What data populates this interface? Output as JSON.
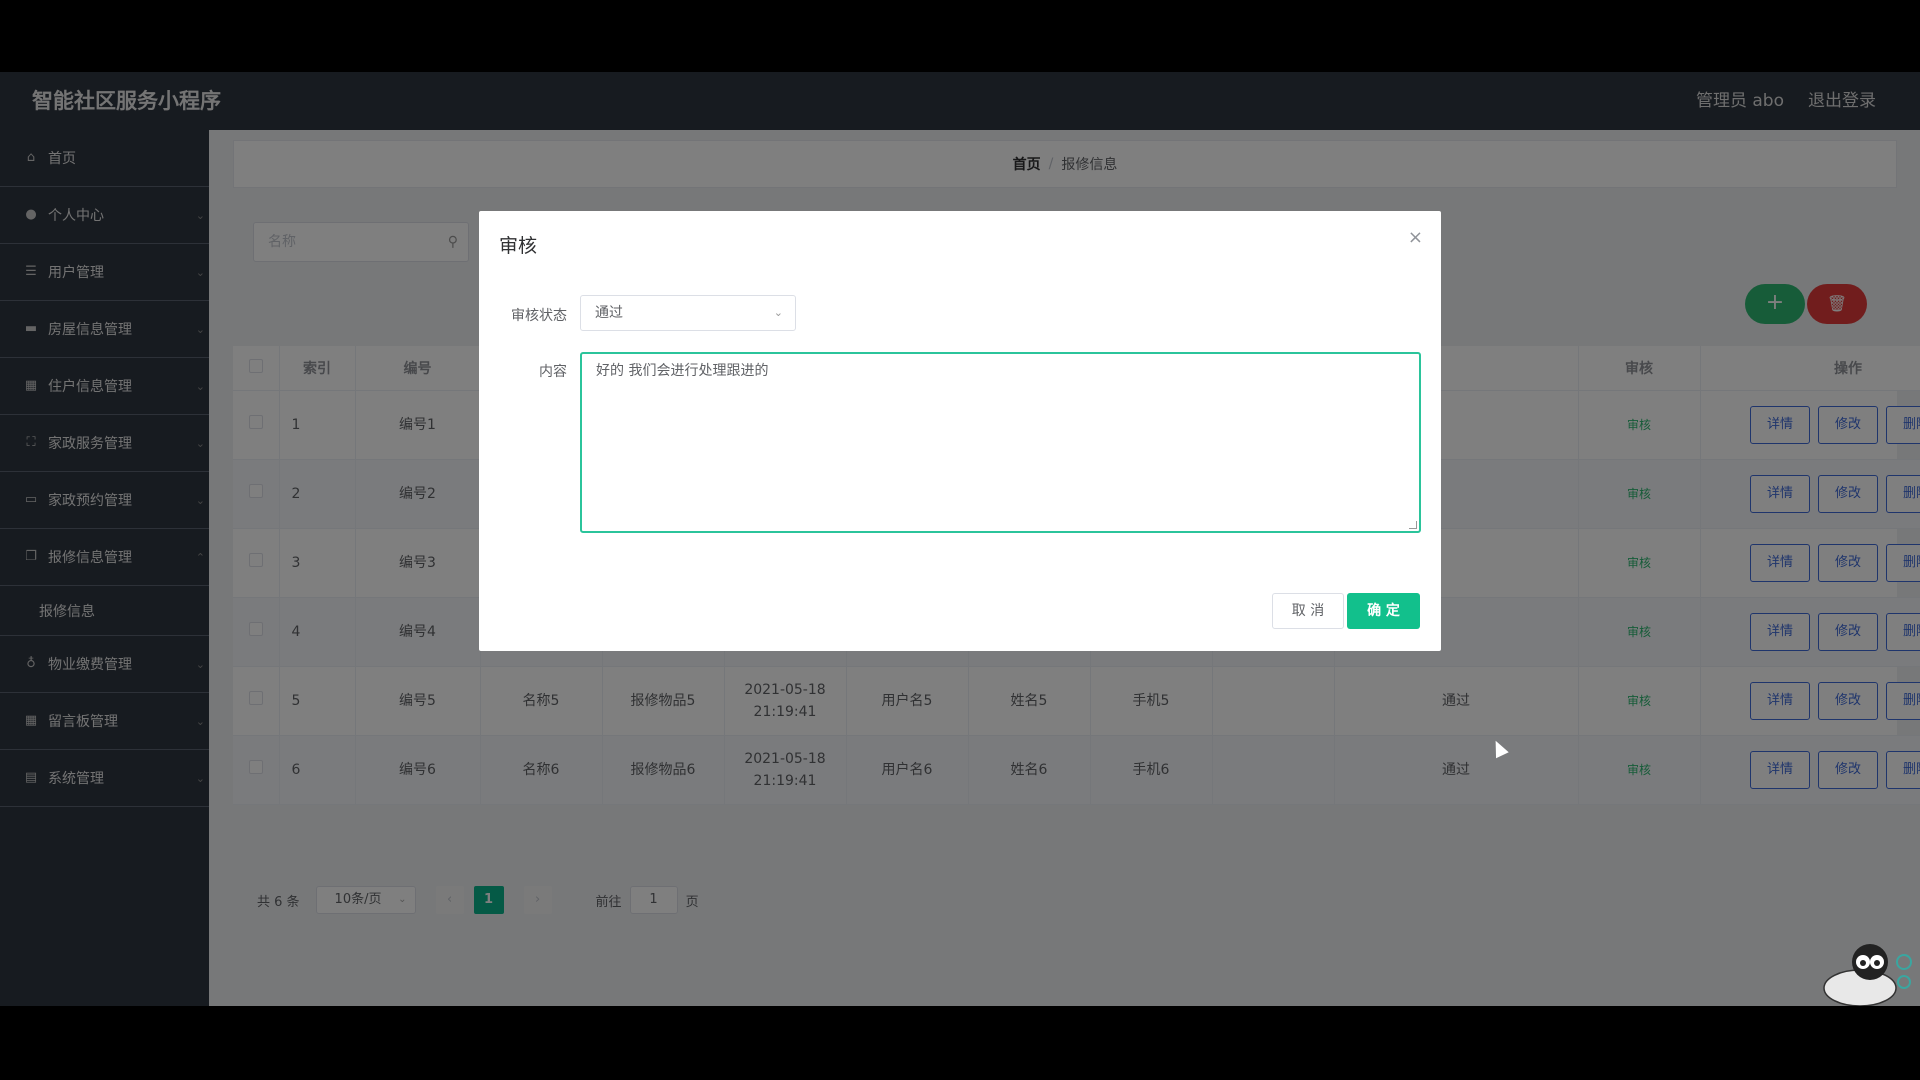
{
  "topbar": {
    "brand": "智能社区服务小程序",
    "admin": "管理员 abo",
    "logout": "退出登录"
  },
  "sidebar": {
    "items": [
      {
        "label": "首页",
        "icon": "home-icon"
      },
      {
        "label": "个人中心",
        "icon": "user-icon"
      },
      {
        "label": "用户管理",
        "icon": "list-icon"
      },
      {
        "label": "房屋信息管理",
        "icon": "flag-icon"
      },
      {
        "label": "住户信息管理",
        "icon": "grid-icon"
      },
      {
        "label": "家政服务管理",
        "icon": "frame-icon"
      },
      {
        "label": "家政预约管理",
        "icon": "calendar-icon"
      },
      {
        "label": "报修信息管理",
        "icon": "copy-icon"
      },
      {
        "label": "报修信息",
        "icon": ""
      },
      {
        "label": "物业缴费管理",
        "icon": "mic-icon"
      },
      {
        "label": "留言板管理",
        "icon": "grid-icon"
      },
      {
        "label": "系统管理",
        "icon": "clipboard-icon"
      }
    ]
  },
  "breadcrumb": {
    "home": "首页",
    "separator": "/",
    "current": "报修信息"
  },
  "search": {
    "placeholder": "名称"
  },
  "toolbar": {
    "add": "+",
    "delete": "🗑"
  },
  "table": {
    "headers": {
      "index": "索引",
      "number": "编号",
      "audit": "审核",
      "ops": "操作"
    },
    "rows": [
      {
        "index": "1",
        "number": "编号1",
        "name": "",
        "item": "",
        "time": "",
        "user": "",
        "realname": "",
        "phone": "",
        "status": ""
      },
      {
        "index": "2",
        "number": "编号2",
        "name": "",
        "item": "",
        "time": "",
        "user": "",
        "realname": "",
        "phone": "",
        "status": ""
      },
      {
        "index": "3",
        "number": "编号3",
        "name": "",
        "item": "",
        "time": "",
        "user": "",
        "realname": "",
        "phone": "",
        "status": ""
      },
      {
        "index": "4",
        "number": "编号4",
        "name": "",
        "item": "",
        "time": "",
        "user": "",
        "realname": "",
        "phone": "",
        "status": ""
      },
      {
        "index": "5",
        "number": "编号5",
        "name": "名称5",
        "item": "报修物品5",
        "time": "2021-05-18 21:19:41",
        "user": "用户名5",
        "realname": "姓名5",
        "phone": "手机5",
        "status": "通过"
      },
      {
        "index": "6",
        "number": "编号6",
        "name": "名称6",
        "item": "报修物品6",
        "time": "2021-05-18 21:19:41",
        "user": "用户名6",
        "realname": "姓名6",
        "phone": "手机6",
        "status": "通过"
      }
    ],
    "audit_link": "审核",
    "op_detail": "详情",
    "op_edit": "修改",
    "op_delete": "删除"
  },
  "pager": {
    "total": "共 6 条",
    "page_size": "10条/页",
    "prev": "‹",
    "current": "1",
    "next": "›",
    "goto": "前往",
    "goto_value": "1",
    "page_unit": "页"
  },
  "dialog": {
    "title": "审核",
    "close": "×",
    "status_label": "审核状态",
    "status_value": "通过",
    "content_label": "内容",
    "content_value": "好的 我们会进行处理跟进的",
    "cancel": "取 消",
    "ok": "确 定"
  },
  "colors": {
    "sidebar": "#2f3640",
    "accent": "#12c08c",
    "link": "#3f6ad8",
    "danger": "#e23b3b"
  }
}
